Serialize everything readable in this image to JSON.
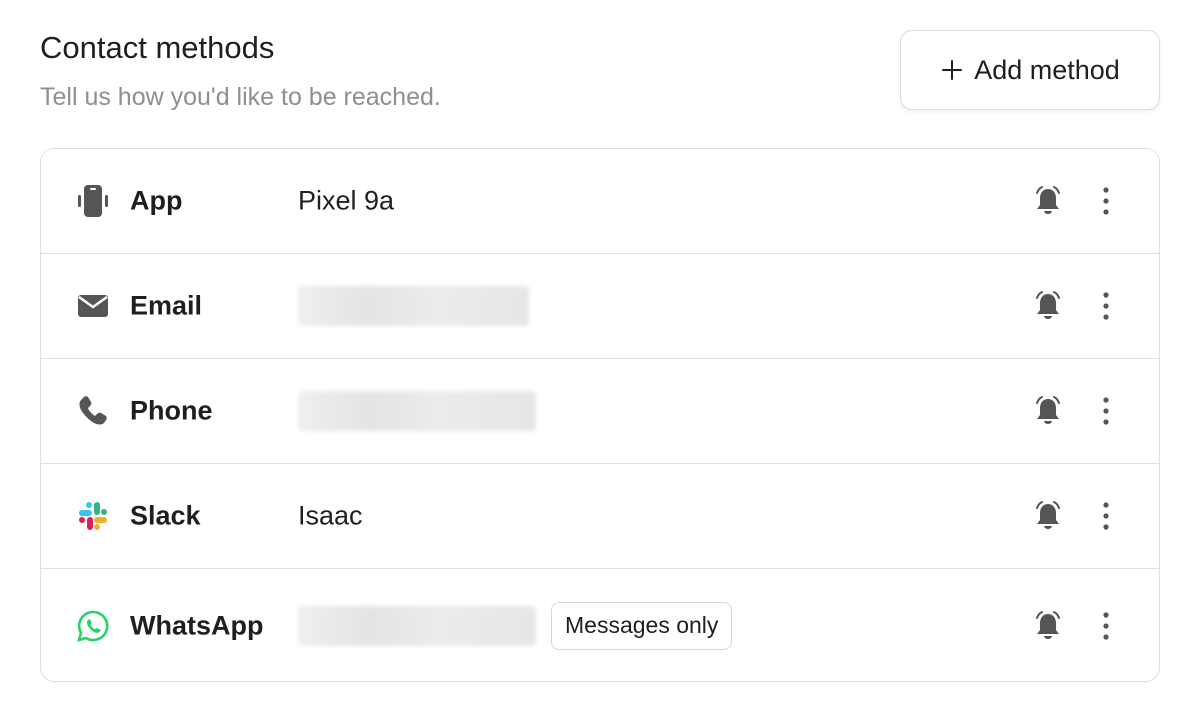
{
  "header": {
    "title": "Contact methods",
    "subtitle": "Tell us how you'd like to be reached.",
    "add_button_label": "Add method"
  },
  "methods": [
    {
      "type": "App",
      "icon": "phone-device-icon",
      "value": "Pixel 9a",
      "value_visible": true
    },
    {
      "type": "Email",
      "icon": "envelope-icon",
      "value": "",
      "value_visible": false
    },
    {
      "type": "Phone",
      "icon": "phone-handset-icon",
      "value": "",
      "value_visible": false
    },
    {
      "type": "Slack",
      "icon": "slack-logo-icon",
      "value": "Isaac",
      "value_visible": true
    },
    {
      "type": "WhatsApp",
      "icon": "whatsapp-logo-icon",
      "value": "",
      "value_visible": false,
      "badge": "Messages only"
    }
  ],
  "colors": {
    "icon_gray": "#555555",
    "whatsapp_green": "#25D366",
    "border": "#e0e0e0",
    "subtitle": "#8f8f8f"
  }
}
